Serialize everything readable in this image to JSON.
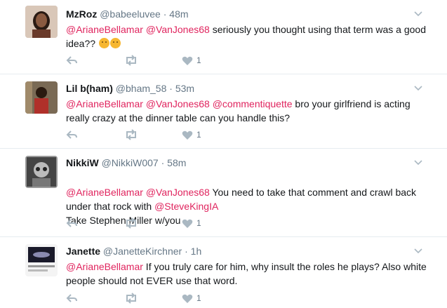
{
  "tweets": [
    {
      "name": "MzRoz",
      "handle": "@babeeluvee",
      "separator": "·",
      "time": "48m",
      "segments": [
        {
          "text": "@ArianeBellamar",
          "mention": true
        },
        {
          "text": " ",
          "mention": false
        },
        {
          "text": "@VanJones68",
          "mention": true
        },
        {
          "text": " seriously you thought using that term was a good idea?? ",
          "mention": false
        }
      ],
      "emoji": [
        "thinking-face",
        "thinking-face"
      ],
      "likes": "1",
      "avatar_color": "#6b4a3a"
    },
    {
      "name": "Lil b(ham)",
      "handle": "@bham_58",
      "separator": "·",
      "time": "53m",
      "segments": [
        {
          "text": "@ArianeBellamar",
          "mention": true
        },
        {
          "text": " ",
          "mention": false
        },
        {
          "text": "@VanJones68",
          "mention": true
        },
        {
          "text": " ",
          "mention": false
        },
        {
          "text": "@commentiquette",
          "mention": true
        },
        {
          "text": " bro your girlfriend is acting really crazy at the dinner table can you handle this?",
          "mention": false
        }
      ],
      "emoji": [],
      "likes": "1",
      "avatar_color": "#3a2a1e"
    },
    {
      "name": "NikkiW",
      "handle": "@NikkiW007",
      "separator": "·",
      "time": "58m",
      "segments": [
        {
          "text": "@ArianeBellamar",
          "mention": true
        },
        {
          "text": " ",
          "mention": false
        },
        {
          "text": "@VanJones68",
          "mention": true
        },
        {
          "text": " You need to take that comment and crawl back under that rock with ",
          "mention": false
        },
        {
          "text": "@SteveKingIA",
          "mention": true
        },
        {
          "text": "\nTake Stephen Miller w/you",
          "mention": false
        }
      ],
      "emoji": [],
      "likes": "1",
      "avatar_color": "#555555"
    },
    {
      "name": "Janette",
      "handle": "@JanetteKirchner",
      "separator": "·",
      "time": "1h",
      "segments": [
        {
          "text": "@ArianeBellamar",
          "mention": true
        },
        {
          "text": " If you truly care for him, why insult the roles he plays? Also white people should not EVER use that word.",
          "mention": false
        }
      ],
      "emoji": [],
      "likes": "1",
      "avatar_color": "#e8e8e8"
    }
  ],
  "colors": {
    "mention": "#e0245e",
    "muted": "#657786",
    "divider": "#e6ecf0",
    "icon": "#aab8c2"
  }
}
